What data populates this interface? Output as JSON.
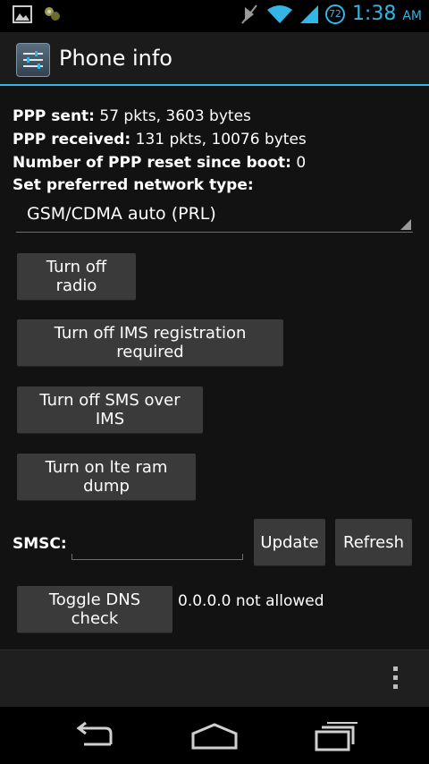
{
  "status_bar": {
    "time": "1:38",
    "ampm": "AM",
    "battery_level": "72",
    "accent_color": "#33b5e5",
    "left_icons": [
      "image-notification-icon",
      "app-notification-icon"
    ],
    "right_icons": [
      "muted-icon",
      "wifi-icon",
      "signal-icon"
    ]
  },
  "action_bar": {
    "title": "Phone info",
    "icon": "settings-sliders-icon"
  },
  "info": {
    "ppp_sent_label": "PPP sent:",
    "ppp_sent_value": " 57 pkts, 3603 bytes",
    "ppp_received_label": "PPP received:",
    "ppp_received_value": " 131 pkts, 10076 bytes",
    "ppp_reset_label": "Number of PPP reset since boot:",
    "ppp_reset_value": " 0",
    "network_type_label": "Set preferred network type:"
  },
  "network_spinner": {
    "selected": "GSM/CDMA auto (PRL)"
  },
  "buttons": {
    "radio": "Turn off radio",
    "ims_registration": "Turn off IMS registration required",
    "sms_over_ims": "Turn off SMS over IMS",
    "lte_ram_dump": "Turn on lte ram dump",
    "update": "Update",
    "refresh": "Refresh",
    "toggle_dns": "Toggle DNS check"
  },
  "smsc": {
    "label": "SMSC:",
    "value": ""
  },
  "dns_status": "0.0.0.0 not allowed",
  "nav": {
    "icons": [
      "back-icon",
      "home-icon",
      "recent-apps-icon"
    ]
  }
}
